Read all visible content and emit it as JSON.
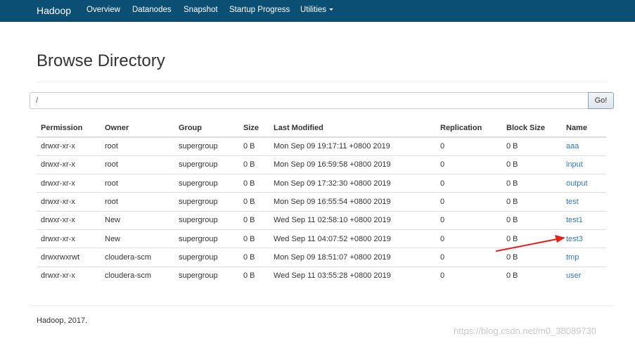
{
  "navbar": {
    "brand": "Hadoop",
    "items": [
      "Overview",
      "Datanodes",
      "Snapshot",
      "Startup Progress",
      "Utilities"
    ]
  },
  "page": {
    "title": "Browse Directory"
  },
  "path_bar": {
    "value": "/",
    "go_label": "Go!"
  },
  "table": {
    "headers": [
      "Permission",
      "Owner",
      "Group",
      "Size",
      "Last Modified",
      "Replication",
      "Block Size",
      "Name"
    ],
    "rows": [
      [
        "drwxr-xr-x",
        "root",
        "supergroup",
        "0 B",
        "Mon Sep 09 19:17:11 +0800 2019",
        "0",
        "0 B",
        "aaa"
      ],
      [
        "drwxr-xr-x",
        "root",
        "supergroup",
        "0 B",
        "Mon Sep 09 16:59:58 +0800 2019",
        "0",
        "0 B",
        "input"
      ],
      [
        "drwxr-xr-x",
        "root",
        "supergroup",
        "0 B",
        "Mon Sep 09 17:32:30 +0800 2019",
        "0",
        "0 B",
        "output"
      ],
      [
        "drwxr-xr-x",
        "root",
        "supergroup",
        "0 B",
        "Mon Sep 09 16:55:54 +0800 2019",
        "0",
        "0 B",
        "test"
      ],
      [
        "drwxr-xr-x",
        "New",
        "supergroup",
        "0 B",
        "Wed Sep 11 02:58:10 +0800 2019",
        "0",
        "0 B",
        "test1"
      ],
      [
        "drwxr-xr-x",
        "New",
        "supergroup",
        "0 B",
        "Wed Sep 11 04:07:52 +0800 2019",
        "0",
        "0 B",
        "test3"
      ],
      [
        "drwxrwxrwt",
        "cloudera-scm",
        "supergroup",
        "0 B",
        "Mon Sep 09 18:51:07 +0800 2019",
        "0",
        "0 B",
        "tmp"
      ],
      [
        "drwxr-xr-x",
        "cloudera-scm",
        "supergroup",
        "0 B",
        "Wed Sep 11 03:55:28 +0800 2019",
        "0",
        "0 B",
        "user"
      ]
    ]
  },
  "footer": {
    "text": "Hadoop, 2017."
  },
  "watermark": {
    "text": "https://blog.csdn.net/m0_38089730"
  },
  "colors": {
    "navbar": "#0b4f74",
    "link": "#337ab7",
    "arrow": "#e8201a"
  }
}
